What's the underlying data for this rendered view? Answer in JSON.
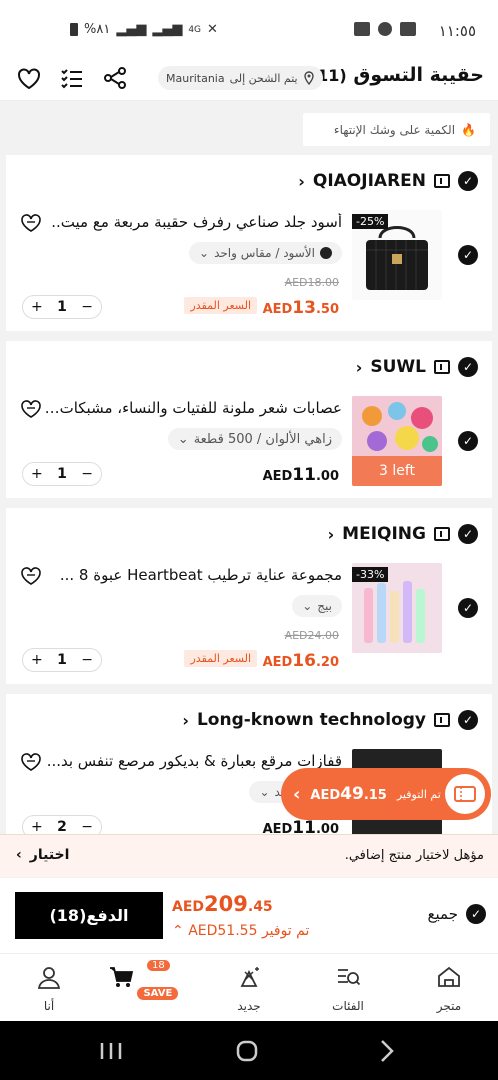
{
  "status_bar": {
    "time": "١١:٥٥",
    "battery": "%٨١",
    "network": "4G"
  },
  "header": {
    "title": "حقيبة التسوق",
    "count": "(11)",
    "shipping_label": "يتم الشحن إلى",
    "location": "Mauritania"
  },
  "notice": {
    "text": "الكمية على وشك الإنتهاء"
  },
  "cart_items": [
    {
      "store": "QIAOJIAREN",
      "name": "أسود جلد صناعي رفرف حقيبة مربعة مع ميت..",
      "variant": "الأسود / مقاس واحد",
      "discount": "-25%",
      "old_price": "AED18.00",
      "price_currency": "AED",
      "price_int": "13",
      "price_dec": ".50",
      "price_label": "السعر المقدر",
      "qty": "1"
    },
    {
      "store": "SUWL",
      "name": "عصابات شعر ملونة للفتيات والنساء، مشبكات ...",
      "variant": "زاهي الألوان / 500 قطعة",
      "stock": "3 left",
      "price_currency": "AED",
      "price_int": "11",
      "price_dec": ".00",
      "qty": "1"
    },
    {
      "store": "MEIQING",
      "name": "مجموعة عناية ترطيب Heartbeat عبوة 8 ...",
      "variant": "بيج",
      "discount": "-33%",
      "old_price": "AED24.00",
      "price_currency": "AED",
      "price_int": "16",
      "price_dec": ".20",
      "price_label": "السعر المقدر",
      "qty": "1"
    },
    {
      "store": "Long-known technology",
      "name": "قفازات مرقع بعبارة & بديكور مرصع تنفس بد...",
      "variant": "مقاس واحد",
      "price_currency": "AED",
      "price_int": "11",
      "price_dec": ".00",
      "qty": "2"
    }
  ],
  "savings_float": {
    "label": "تم التوفير",
    "currency": "AED",
    "amount_int": "49",
    "amount_dec": ".15"
  },
  "extra_bar": {
    "text": "مؤهل لاختيار منتج إضافي.",
    "button": "اختيار"
  },
  "checkout": {
    "pay_label": "الدفع(18)",
    "total_currency": "AED",
    "total_int": "209",
    "total_dec": ".45",
    "saved_label": "تم توفير",
    "saved_amount": "AED51.55",
    "all_label": "جميع"
  },
  "tabbar": {
    "items": [
      {
        "label": "متجر",
        "icon": "store-icon"
      },
      {
        "label": "الفئات",
        "icon": "categories-icon"
      },
      {
        "label": "جديد",
        "icon": "new-icon"
      },
      {
        "label": "SAVE",
        "icon": "cart-icon",
        "badge": "18"
      },
      {
        "label": "أنا",
        "icon": "profile-icon"
      }
    ]
  },
  "colors": {
    "accent": "#f36b3b",
    "price": "#e8541f",
    "background": "#f2f2f2"
  }
}
